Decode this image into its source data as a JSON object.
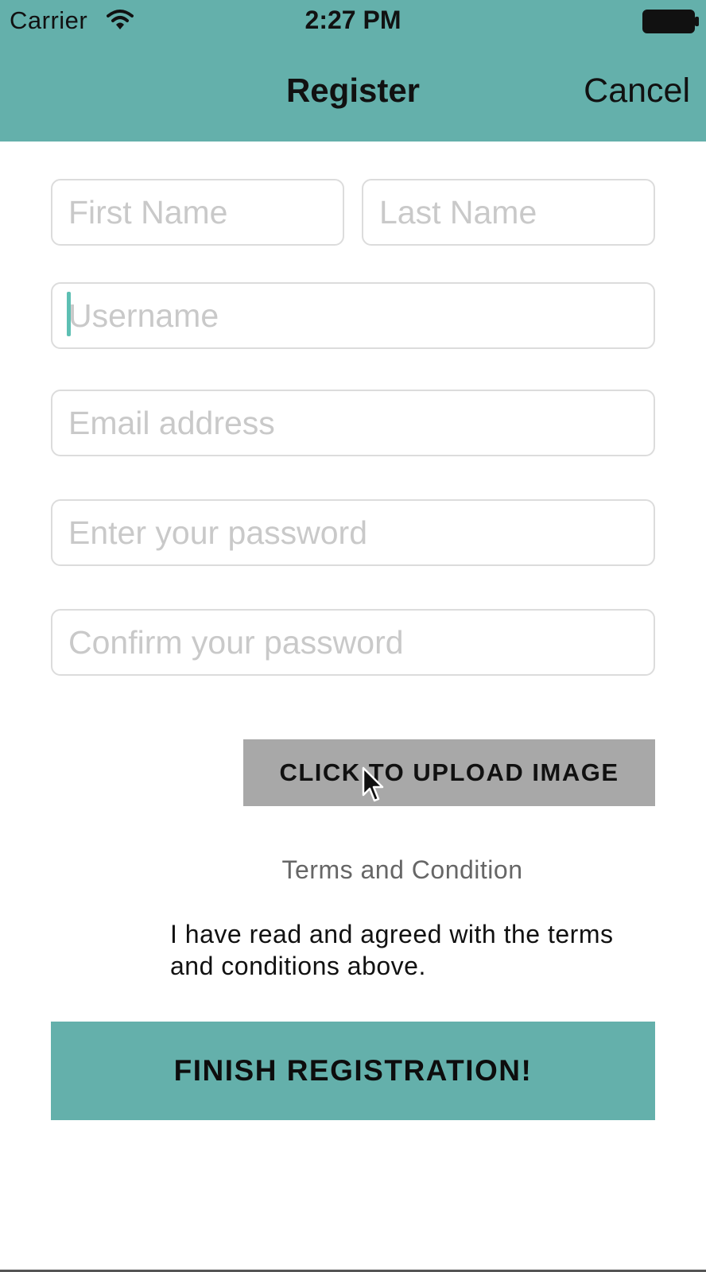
{
  "status_bar": {
    "carrier": "Carrier",
    "time": "2:27 PM",
    "icons": [
      "wifi-icon",
      "battery-icon"
    ]
  },
  "nav": {
    "title": "Register",
    "cancel_label": "Cancel"
  },
  "form": {
    "first_name_placeholder": "First Name",
    "last_name_placeholder": "Last Name",
    "username_placeholder": "Username",
    "email_placeholder": "Email address",
    "password_placeholder": "Enter your password",
    "confirm_placeholder": "Confirm your password",
    "upload_label": "CLICK TO UPLOAD IMAGE",
    "terms_label": "Terms and Condition",
    "agree_text": "I have read and agreed with the terms and conditions above.",
    "finish_label": "FINISH REGISTRATION!"
  },
  "colors": {
    "accent": "#64b0ab",
    "upload_button": "#a8a8a8",
    "caret": "#5dbfb3",
    "placeholder": "#c9c9c9"
  }
}
